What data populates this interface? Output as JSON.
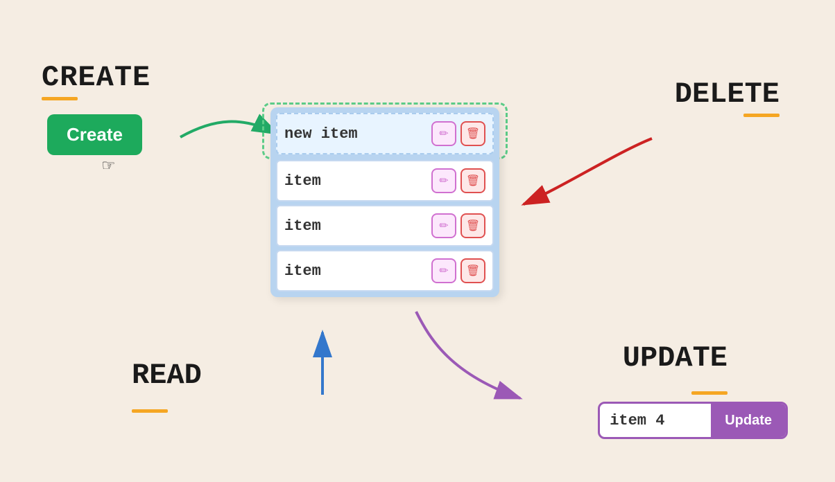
{
  "background_color": "#f5ede3",
  "labels": {
    "create": "CREATE",
    "delete": "DELETE",
    "read": "READ",
    "update": "UPDATE"
  },
  "create_button": {
    "label": "Create"
  },
  "update_form": {
    "input_value": "item 4",
    "button_label": "Update"
  },
  "list": {
    "new_item_text": "new item",
    "items": [
      {
        "text": "item"
      },
      {
        "text": "item"
      },
      {
        "text": "item"
      }
    ]
  },
  "icons": {
    "edit": "✏",
    "trash": "🗑",
    "cursor": "☞"
  }
}
